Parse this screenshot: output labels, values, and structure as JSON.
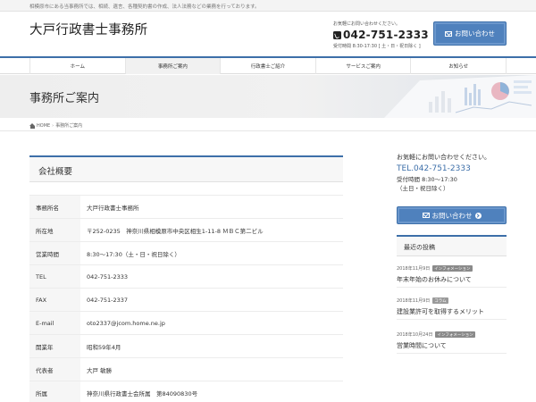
{
  "topbar": {
    "text": "相模原市にある当事務所では、相続、遺言、各種契約書の作成、法人法務などの業務を行っております。"
  },
  "header": {
    "logo": "大戸行政書士事務所",
    "contact_note": "お気軽にお問い合わせください。",
    "phone": "042-751-2333",
    "hours": "受付時間 8:30-17:30 [ 土・日・祝日除く ]",
    "contact_button": "お問い合わせ"
  },
  "nav": {
    "items": [
      {
        "label": "ホーム"
      },
      {
        "label": "事務所ご案内"
      },
      {
        "label": "行政書士ご紹介"
      },
      {
        "label": "サービスご案内"
      },
      {
        "label": "お知らせ"
      }
    ],
    "active_index": 1
  },
  "hero": {
    "title": "事務所ご案内"
  },
  "breadcrumb": {
    "home": "HOME",
    "current": "事務所ご案内"
  },
  "main": {
    "section_title": "会社概要",
    "rows": [
      {
        "label": "事務所名",
        "value": "大戸行政書士事務所"
      },
      {
        "label": "所在地",
        "value": "〒252-0235　神奈川県相模原市中央区相生1-11-8 ＭＢＣ第二ビル"
      },
      {
        "label": "営業時間",
        "value": "8:30〜17:30（土・日・祝日除く）"
      },
      {
        "label": "TEL",
        "value": "042-751-2333"
      },
      {
        "label": "FAX",
        "value": "042-751-2337"
      },
      {
        "label": "E-mail",
        "value": "oto2337@jcom.home.ne.jp"
      },
      {
        "label": "開業年",
        "value": "昭和59年4月"
      },
      {
        "label": "代表者",
        "value": "大戸 敏勝"
      },
      {
        "label": "所属",
        "value": "神奈川県行政書士会所属　第84090830号"
      }
    ]
  },
  "sidebar": {
    "contact_text": "お気軽にお問い合わせください。",
    "tel": "TEL.042-751-2333",
    "hours_line1": "受付時間 8:30〜17:30",
    "hours_line2": "（土日・祝日除く）",
    "contact_button": "お問い合わせ",
    "recent_title": "最近の投稿",
    "posts": [
      {
        "date": "2018年11月9日",
        "category": "インフォメーション",
        "category_color": "#8a8a8a",
        "title": "年末年始のお休みについて"
      },
      {
        "date": "2018年11月9日",
        "category": "コラム",
        "category_color": "#9a9a9a",
        "title": "建設業許可を取得するメリット"
      },
      {
        "date": "2018年10月24日",
        "category": "インフォメーション",
        "category_color": "#8a8a8a",
        "title": "営業時間について"
      }
    ]
  },
  "colors": {
    "accent": "#3d6fa9",
    "button": "#4f81bd"
  }
}
